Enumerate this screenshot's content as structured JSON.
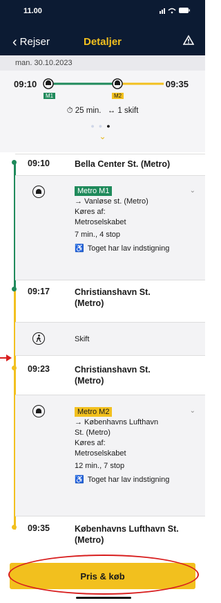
{
  "status_bar": {
    "time": "11.00",
    "icons": "signal wifi battery"
  },
  "nav": {
    "back_label": "Rejser",
    "title": "Detaljer",
    "right_icon": "alert-triangle-icon"
  },
  "date": "man. 30.10.2023",
  "overview": {
    "depart_time": "09:10",
    "arrive_time": "09:35",
    "line1_badge": "M1",
    "line2_badge": "M2",
    "duration": "25 min.",
    "changes": "1 skift",
    "page_dots": [
      false,
      false,
      true
    ]
  },
  "colors": {
    "m1": "#1f8a5b",
    "m2": "#f2c01e",
    "header": "#0c1b33",
    "accent": "#f2c01e",
    "annotation": "#d81e1e"
  },
  "stops": [
    {
      "time": "09:10",
      "name": "Bella Center St. (Metro)"
    },
    {
      "time": "09:17",
      "name": "Christianshavn St. (Metro)"
    },
    {
      "time": "09:23",
      "name": "Christianshavn St. (Metro)"
    },
    {
      "time": "09:35",
      "name": "Københavns Lufthavn St. (Metro)"
    }
  ],
  "legs": [
    {
      "line_label": "Metro M1",
      "direction": "→ Vanløse st. (Metro)",
      "operator": "Køres af: Metroselskabet",
      "duration_stops": "7 min., 4 stop",
      "accessibility": "Toget har lav indstigning"
    },
    {
      "line_label": "Metro M2",
      "direction": "→ Københavns Lufthavn St. (Metro)",
      "operator": "Køres af: Metroselskabet",
      "duration_stops": "12 min., 7 stop",
      "accessibility": "Toget har lav indstigning"
    }
  ],
  "transfer": {
    "label": "Skift"
  },
  "button": {
    "label": "Pris & køb"
  }
}
